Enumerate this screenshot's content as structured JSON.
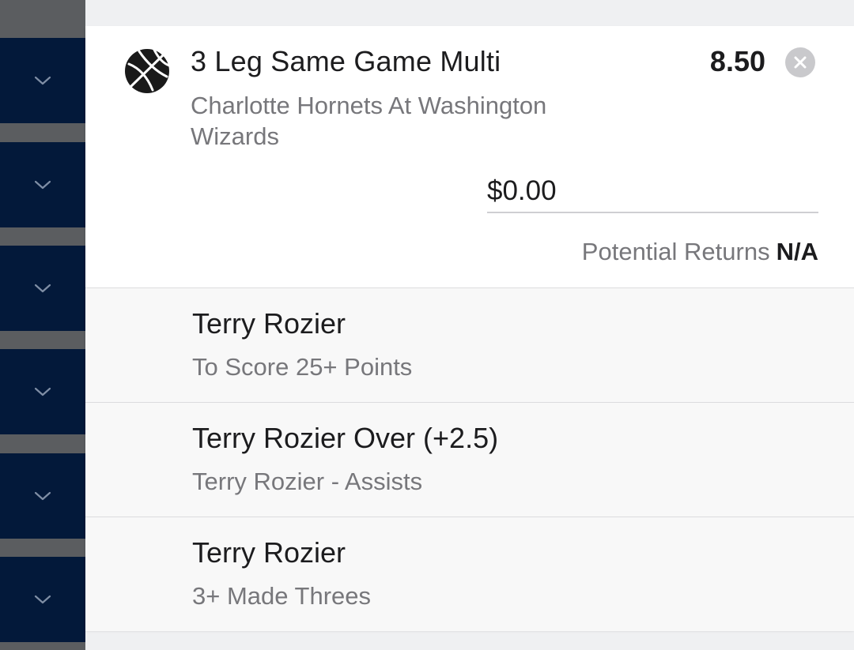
{
  "sidebar": {
    "items": [
      {
        "icon": "chevron-down-icon"
      },
      {
        "icon": "chevron-down-icon"
      },
      {
        "icon": "chevron-down-icon"
      },
      {
        "icon": "chevron-down-icon"
      },
      {
        "icon": "chevron-down-icon"
      },
      {
        "icon": "chevron-down-icon"
      }
    ]
  },
  "bet": {
    "sport_icon": "basketball-icon",
    "title": "3 Leg Same Game Multi",
    "odds": "8.50",
    "event": "Charlotte Hornets At Washington Wizards",
    "stake_placeholder": "$0.00",
    "returns_label": "Potential Returns",
    "returns_value": "N/A",
    "close_icon": "close-icon"
  },
  "legs": [
    {
      "selection": "Terry Rozier",
      "market": "To Score 25+ Points"
    },
    {
      "selection": "Terry Rozier Over (+2.5)",
      "market": "Terry Rozier - Assists"
    },
    {
      "selection": "Terry Rozier",
      "market": "3+ Made Threes"
    }
  ],
  "colors": {
    "sidebar_navy": "#03193a",
    "sidebar_gap": "#5b5d60",
    "page_background": "#eff0f2",
    "card_background": "#ffffff",
    "leg_background": "#f8f8f8",
    "primary_text": "#1c1c1e",
    "secondary_text": "#77777b",
    "close_button": "#c9c9cc"
  }
}
